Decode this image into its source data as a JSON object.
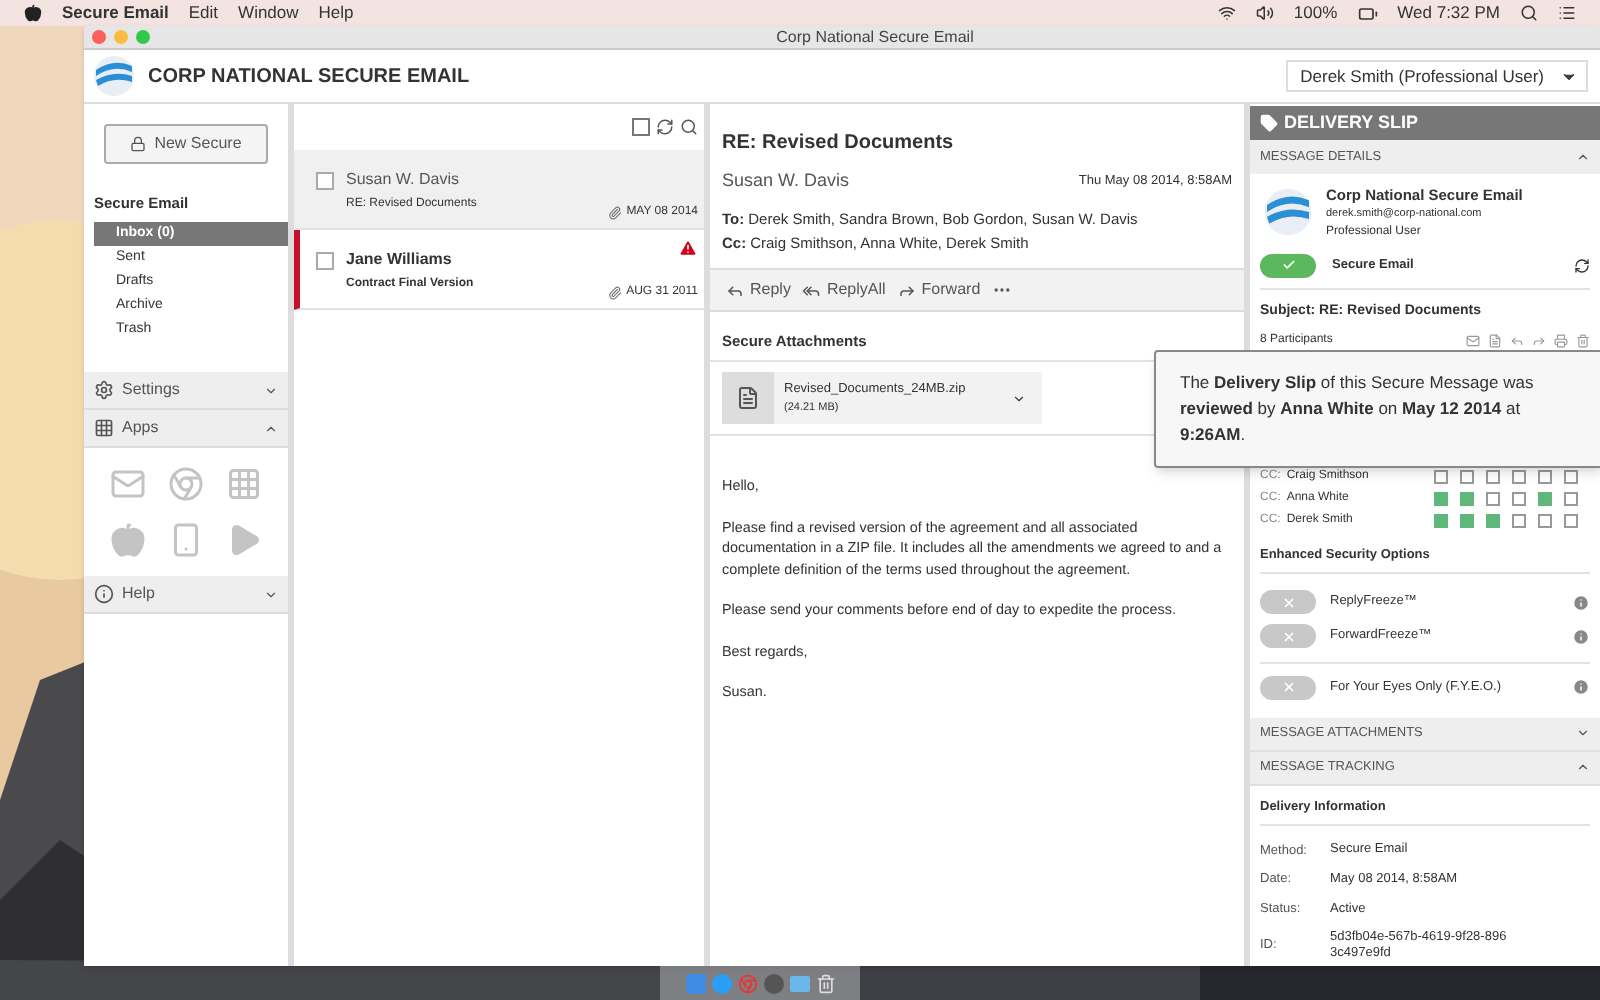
{
  "menubar": {
    "app": "Secure Email",
    "menus": [
      "Edit",
      "Window",
      "Help"
    ],
    "battery": "100%",
    "clock": "Wed 7:32 PM"
  },
  "window": {
    "title": "Corp National Secure Email"
  },
  "header": {
    "brand": "CORP NATIONAL SECURE EMAIL",
    "user": "Derek Smith (Professional User)"
  },
  "sidebar": {
    "new_button": "New Secure",
    "heading": "Secure Email",
    "items": [
      {
        "label": "Inbox (0)",
        "selected": true
      },
      {
        "label": "Sent",
        "selected": false
      },
      {
        "label": "Drafts",
        "selected": false
      },
      {
        "label": "Archive",
        "selected": false
      },
      {
        "label": "Trash",
        "selected": false
      }
    ],
    "sections": [
      {
        "kind": "settings",
        "label": "Settings",
        "expanded": false
      },
      {
        "kind": "apps",
        "label": "Apps",
        "expanded": true
      },
      {
        "kind": "help",
        "label": "Help",
        "expanded": false
      }
    ]
  },
  "list_toolbar": {
    "select_all": false
  },
  "messages": [
    {
      "sender": "Susan W. Davis",
      "subject": "RE: Revised Documents",
      "date": "MAY 08 2014",
      "selected": true,
      "flagged": false
    },
    {
      "sender": "Jane Williams",
      "subject": "Contract Final Version",
      "date": "AUG 31 2011",
      "selected": false,
      "flagged": true
    }
  ],
  "reading": {
    "subject": "RE: Revised Documents",
    "sender": "Susan W. Davis",
    "date": "Thu May 08 2014, 8:58AM",
    "to_label": "To:",
    "to": "Derek Smith, Sandra Brown, Bob Gordon, Susan W. Davis",
    "cc_label": "Cc:",
    "cc": "Craig Smithson, Anna White, Derek Smith",
    "actions": [
      "Reply",
      "ReplyAll",
      "Forward"
    ],
    "attachments_heading": "Secure Attachments",
    "file_name": "Revised_Documents_24MB.zip",
    "file_size": "(24.21 MB)",
    "body": [
      "Hello,",
      "Please find a revised version of the agreement and all associated documentation in a ZIP file. It includes all the amendments we agreed to and a complete definition of the terms used throughout the agreement.",
      "Please send your comments before end of day to expedite the process.",
      "Best regards,",
      "Susan."
    ]
  },
  "delivery_slip": {
    "title": "DELIVERY SLIP",
    "details_heading": "MESSAGE DETAILS",
    "details_expanded": true,
    "org": "Corp National Secure Email",
    "email": "derek.smith@corp-national.com",
    "role": "Professional User",
    "secure_label": "Secure Email",
    "secure_on": true,
    "subject": "Subject: RE: Revised Documents",
    "participants_count": "8 Participants",
    "participants": [
      {
        "type": "CC:",
        "name": "Craig Smithson",
        "marks": [
          {
            "filled": false
          },
          {
            "filled": false
          },
          {
            "filled": false
          },
          {
            "filled": false
          },
          {
            "filled": false
          },
          {
            "filled": false
          }
        ]
      },
      {
        "type": "CC:",
        "name": "Anna White",
        "marks": [
          {
            "filled": true
          },
          {
            "filled": true
          },
          {
            "filled": false
          },
          {
            "filled": false
          },
          {
            "filled": true
          },
          {
            "filled": false
          }
        ]
      },
      {
        "type": "CC:",
        "name": "Derek Smith",
        "marks": [
          {
            "filled": true
          },
          {
            "filled": true
          },
          {
            "filled": true
          },
          {
            "filled": false
          },
          {
            "filled": false
          },
          {
            "filled": false
          }
        ]
      }
    ],
    "options_heading": "Enhanced Security Options",
    "options": [
      {
        "label": "ReplyFreeze™",
        "on": false
      },
      {
        "label": "ForwardFreeze™",
        "on": false
      },
      {
        "label": "For Your Eyes Only (F.Y.E.O.)",
        "on": false
      }
    ],
    "sections": [
      {
        "label": "MESSAGE ATTACHMENTS",
        "expanded": false
      },
      {
        "label": "MESSAGE TRACKING",
        "expanded": true
      }
    ],
    "tracking_heading": "Delivery Information",
    "tracking": [
      {
        "key": "Method:",
        "value": "Secure Email"
      },
      {
        "key": "Date:",
        "value": "May 08 2014, 8:58AM"
      },
      {
        "key": "Status:",
        "value": "Active"
      },
      {
        "key": "ID:",
        "value": "5d3fb04e-567b-4619-9f28-8963c497e9fd"
      }
    ]
  },
  "tooltip": {
    "text": "The **Delivery Slip** of this Secure Message was **reviewed** by **Anna White** on **May 12 2014** at **9:26AM**."
  }
}
